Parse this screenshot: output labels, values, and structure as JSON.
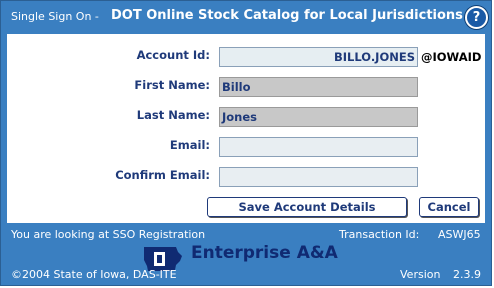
{
  "header": {
    "prefix": "Single Sign On -",
    "title": "DOT Online Stock Catalog for Local Jurisdictions",
    "help_label": "?"
  },
  "form": {
    "account_id": {
      "label": "Account Id:",
      "value": "BILLO.JONES",
      "suffix": "@IOWAID"
    },
    "first_name": {
      "label": "First Name:",
      "value": "Billo"
    },
    "last_name": {
      "label": "Last Name:",
      "value": "Jones"
    },
    "email": {
      "label": "Email:",
      "value": ""
    },
    "confirm_email": {
      "label": "Confirm Email:",
      "value": ""
    }
  },
  "actions": {
    "save_label": "Save Account Details",
    "cancel_label": "Cancel"
  },
  "footer": {
    "location_text": "You are looking at SSO Registration",
    "transaction_label": "Transaction Id:",
    "transaction_id": "ASWJ65",
    "brand": "Enterprise A&A",
    "copyright": "©2004 State of Iowa, DAS-ITE",
    "version_label": "Version",
    "version": "2.3.9"
  },
  "colors": {
    "frame": "#3a7fc1",
    "label_text": "#1f3a7a",
    "readonly_field": "#c8c8c8",
    "brand_text": "#102a72"
  },
  "icons": {
    "help": "help-icon",
    "logo": "iowa-state-logo-icon"
  }
}
